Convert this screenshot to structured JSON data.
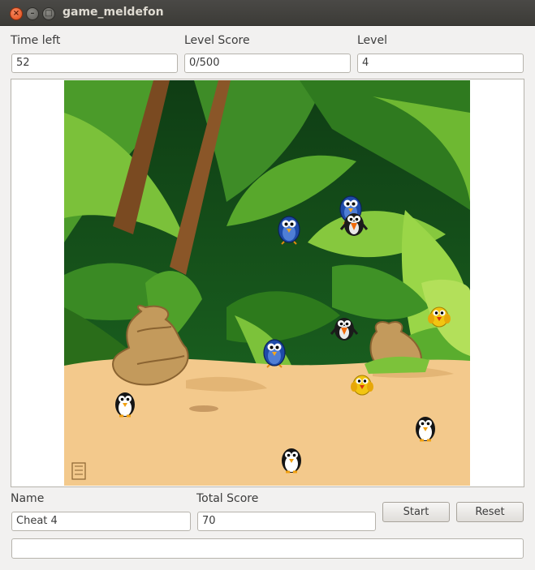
{
  "window": {
    "title": "game_meldefon"
  },
  "stats": {
    "time_left_label": "Time left",
    "time_left_value": "52",
    "level_score_label": "Level Score",
    "level_score_value": "0/500",
    "level_label": "Level",
    "level_value": "4"
  },
  "player": {
    "name_label": "Name",
    "name_value": "Cheat 4",
    "total_score_label": "Total Score",
    "total_score_value": "70"
  },
  "buttons": {
    "start": "Start",
    "reset": "Reset"
  },
  "status_bar": {
    "text": ""
  },
  "board": {
    "background": "jungle",
    "birds": [
      {
        "kind": "blue-bird"
      },
      {
        "kind": "blue-bird"
      },
      {
        "kind": "blue-bird"
      },
      {
        "kind": "black-bird"
      },
      {
        "kind": "black-bird"
      },
      {
        "kind": "penguin"
      },
      {
        "kind": "penguin"
      },
      {
        "kind": "penguin"
      },
      {
        "kind": "yellow-bird"
      },
      {
        "kind": "yellow-bird"
      }
    ]
  }
}
